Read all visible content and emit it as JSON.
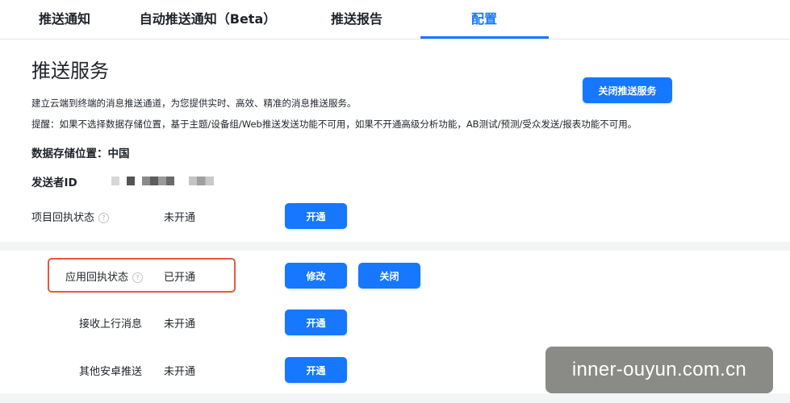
{
  "tabs": [
    {
      "label": "推送通知"
    },
    {
      "label": "自动推送通知（Beta）"
    },
    {
      "label": "推送报告"
    },
    {
      "label": "配置",
      "active": true
    }
  ],
  "service": {
    "title": "推送服务",
    "description": "建立云端到终端的消息推送通道，为您提供实时、高效、精准的消息推送服务。",
    "tip": "提醒：如果不选择数据存储位置，基于主题/设备组/Web推送发送功能不可用，如果不开通高级分析功能，AB测试/预测/受众发送/报表功能不可用。",
    "close_button": "关闭推送服务",
    "storage_label": "数据存储位置：中国",
    "sender_label": "发送者ID"
  },
  "rows": [
    {
      "label": "项目回执状态",
      "status": "未开通",
      "buttons": [
        "开通"
      ],
      "help": "?"
    },
    {
      "label": "应用回执状态",
      "status": "已开通",
      "buttons": [
        "修改",
        "关闭"
      ],
      "help": "?"
    },
    {
      "label": "接收上行消息",
      "status": "未开通",
      "buttons": [
        "开通"
      ]
    },
    {
      "label": "其他安卓推送",
      "status": "未开通",
      "buttons": [
        "开通"
      ]
    }
  ],
  "watermark": "inner-ouyun.com.cn",
  "colors": {
    "accent": "#1677ff",
    "highlight": "#e8573b"
  }
}
